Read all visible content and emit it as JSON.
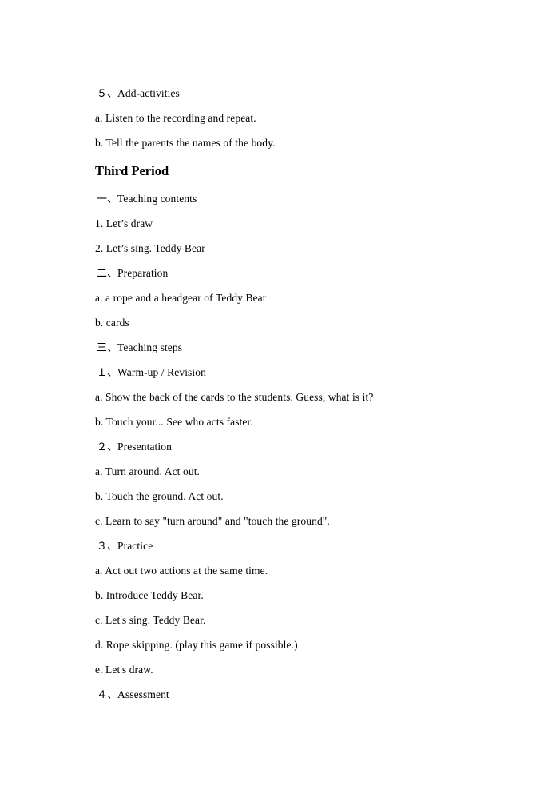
{
  "document": {
    "background_color": "#ffffff",
    "text_color": "#000000",
    "blocks": [
      {
        "kind": "numbered",
        "marker": "５、",
        "text": "Add-activities"
      },
      {
        "kind": "item",
        "text": "a. Listen to the recording and repeat."
      },
      {
        "kind": "item",
        "text": "b. Tell the parents the names of the body."
      },
      {
        "kind": "heading",
        "text": "Third Period"
      },
      {
        "kind": "numbered",
        "marker": "一、",
        "text": "Teaching contents"
      },
      {
        "kind": "item",
        "text": "1. Let’s draw"
      },
      {
        "kind": "item",
        "text": "2. Let’s sing. Teddy Bear"
      },
      {
        "kind": "numbered",
        "marker": "二、",
        "text": "Preparation"
      },
      {
        "kind": "item",
        "text": "a. a rope and a headgear of Teddy Bear"
      },
      {
        "kind": "item",
        "text": "b. cards"
      },
      {
        "kind": "numbered",
        "marker": "三、",
        "text": "Teaching steps"
      },
      {
        "kind": "numbered",
        "marker": "１、",
        "text": "Warm-up / Revision"
      },
      {
        "kind": "item",
        "text": "a. Show the back of the cards to the students. Guess, what is it?"
      },
      {
        "kind": "item",
        "text": "b. Touch your... See who acts faster."
      },
      {
        "kind": "numbered",
        "marker": "２、",
        "text": "Presentation"
      },
      {
        "kind": "item",
        "text": "a. Turn around. Act out."
      },
      {
        "kind": "item",
        "text": "b. Touch the ground. Act out."
      },
      {
        "kind": "item",
        "text": "c. Learn to say \"turn around\" and \"touch the ground\"."
      },
      {
        "kind": "numbered",
        "marker": "３、",
        "text": "Practice"
      },
      {
        "kind": "item",
        "text": "a. Act out two actions at the same time."
      },
      {
        "kind": "item",
        "text": "b. Introduce Teddy Bear."
      },
      {
        "kind": "item",
        "text": "c. Let's sing. Teddy Bear."
      },
      {
        "kind": "item",
        "text": "d. Rope skipping. (play this game if possible.)"
      },
      {
        "kind": "item",
        "text": "e. Let's draw."
      },
      {
        "kind": "numbered",
        "marker": "４、",
        "text": "Assessment"
      }
    ]
  }
}
